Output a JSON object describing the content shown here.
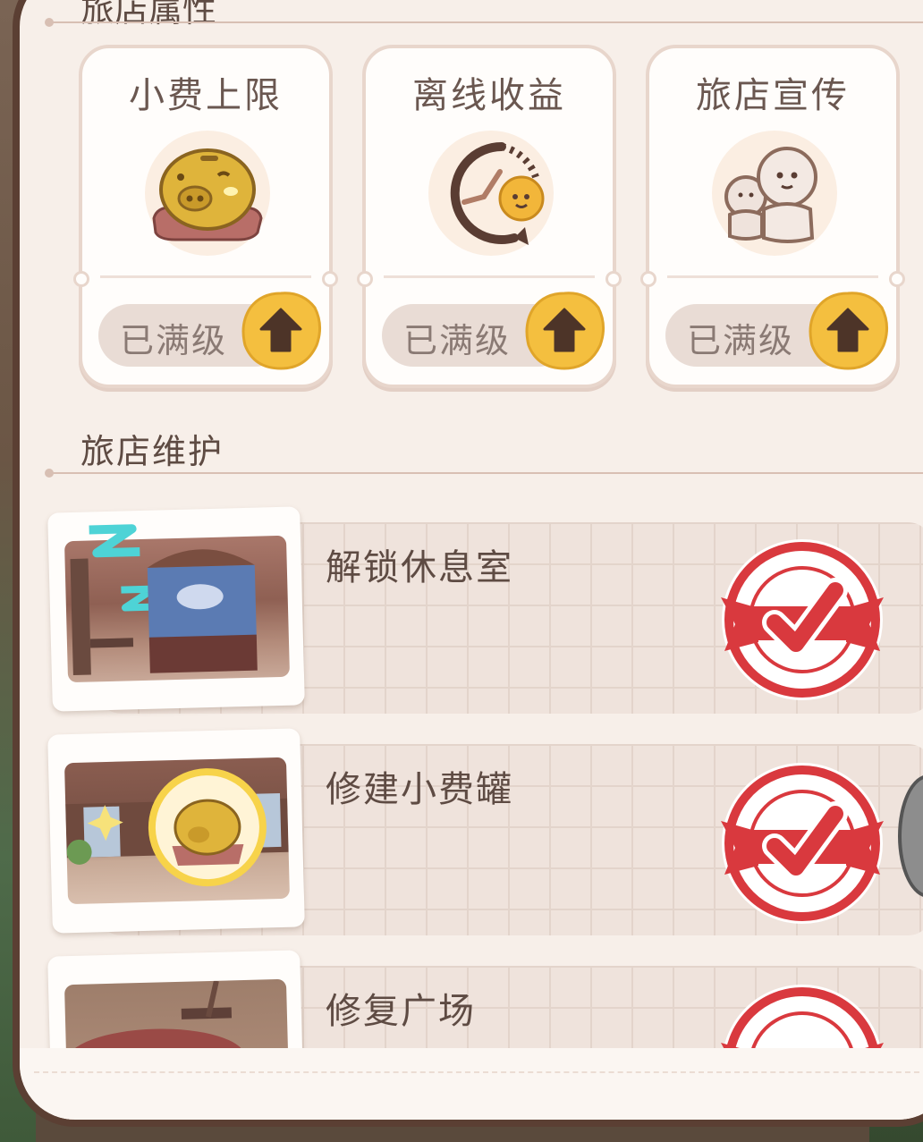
{
  "top_section": {
    "partial_title": "旅店属性"
  },
  "cards": [
    {
      "title": "小费上限",
      "status": "已满级",
      "icon": "piggy-bank-icon"
    },
    {
      "title": "离线收益",
      "status": "已满级",
      "icon": "clock-icon"
    },
    {
      "title": "旅店宣传",
      "status": "已满级",
      "icon": "people-icon"
    }
  ],
  "maintenance": {
    "title": "旅店维护",
    "tasks": [
      {
        "label": "解锁休息室",
        "icon": "completed-stamp-icon"
      },
      {
        "label": "修建小费罐",
        "icon": "completed-stamp-icon"
      },
      {
        "label": "修复广场",
        "icon": "completed-stamp-icon"
      }
    ]
  },
  "colors": {
    "accent": "#f5c245",
    "stamp_red": "#d9393e",
    "text": "#5e4b43",
    "panel": "#f7efe9"
  }
}
